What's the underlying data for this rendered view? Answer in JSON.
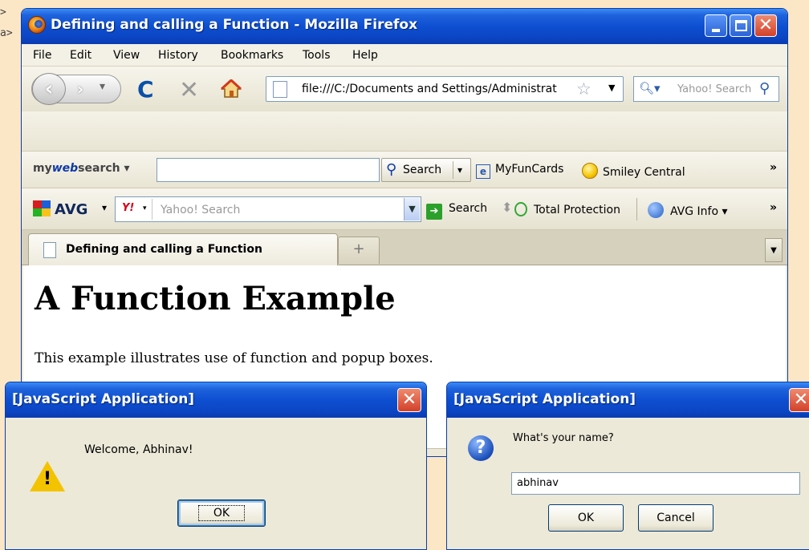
{
  "background_fragments": [
    ">",
    "a>"
  ],
  "window": {
    "title": "Defining and calling a Function - Mozilla Firefox",
    "controls": {
      "minimize": "minimize-icon",
      "maximize": "maximize-icon",
      "close": "close-icon"
    }
  },
  "menu": [
    "File",
    "Edit",
    "View",
    "History",
    "Bookmarks",
    "Tools",
    "Help"
  ],
  "nav": {
    "url": "file:///C:/Documents and Settings/Administrat",
    "search_placeholder": "Yahoo! Search"
  },
  "mywebsearch": {
    "logo_my": "my",
    "logo_web": "web",
    "logo_search": "search",
    "search_button": "Search",
    "links": [
      "MyFunCards",
      "Smiley Central"
    ]
  },
  "avg": {
    "logo": "AVG",
    "search_placeholder": "Yahoo! Search",
    "search_button": "Search",
    "total_protection": "Total Protection",
    "info": "AVG Info"
  },
  "tabs": {
    "active": "Defining and calling a Function",
    "new_tab_symbol": "+"
  },
  "page": {
    "heading": "A Function Example",
    "paragraph": "This example illustrates use of function and popup boxes."
  },
  "alert_dialog": {
    "title": "[JavaScript Application]",
    "message": "Welcome, Abhinav!",
    "ok": "OK"
  },
  "prompt_dialog": {
    "title": "[JavaScript Application]",
    "message": "What's your name?",
    "value": "abhinav",
    "ok": "OK",
    "cancel": "Cancel"
  },
  "colors": {
    "titlebar": "#0d4fd1",
    "page_background": "#fbe6c6",
    "chrome": "#ece9d8"
  }
}
